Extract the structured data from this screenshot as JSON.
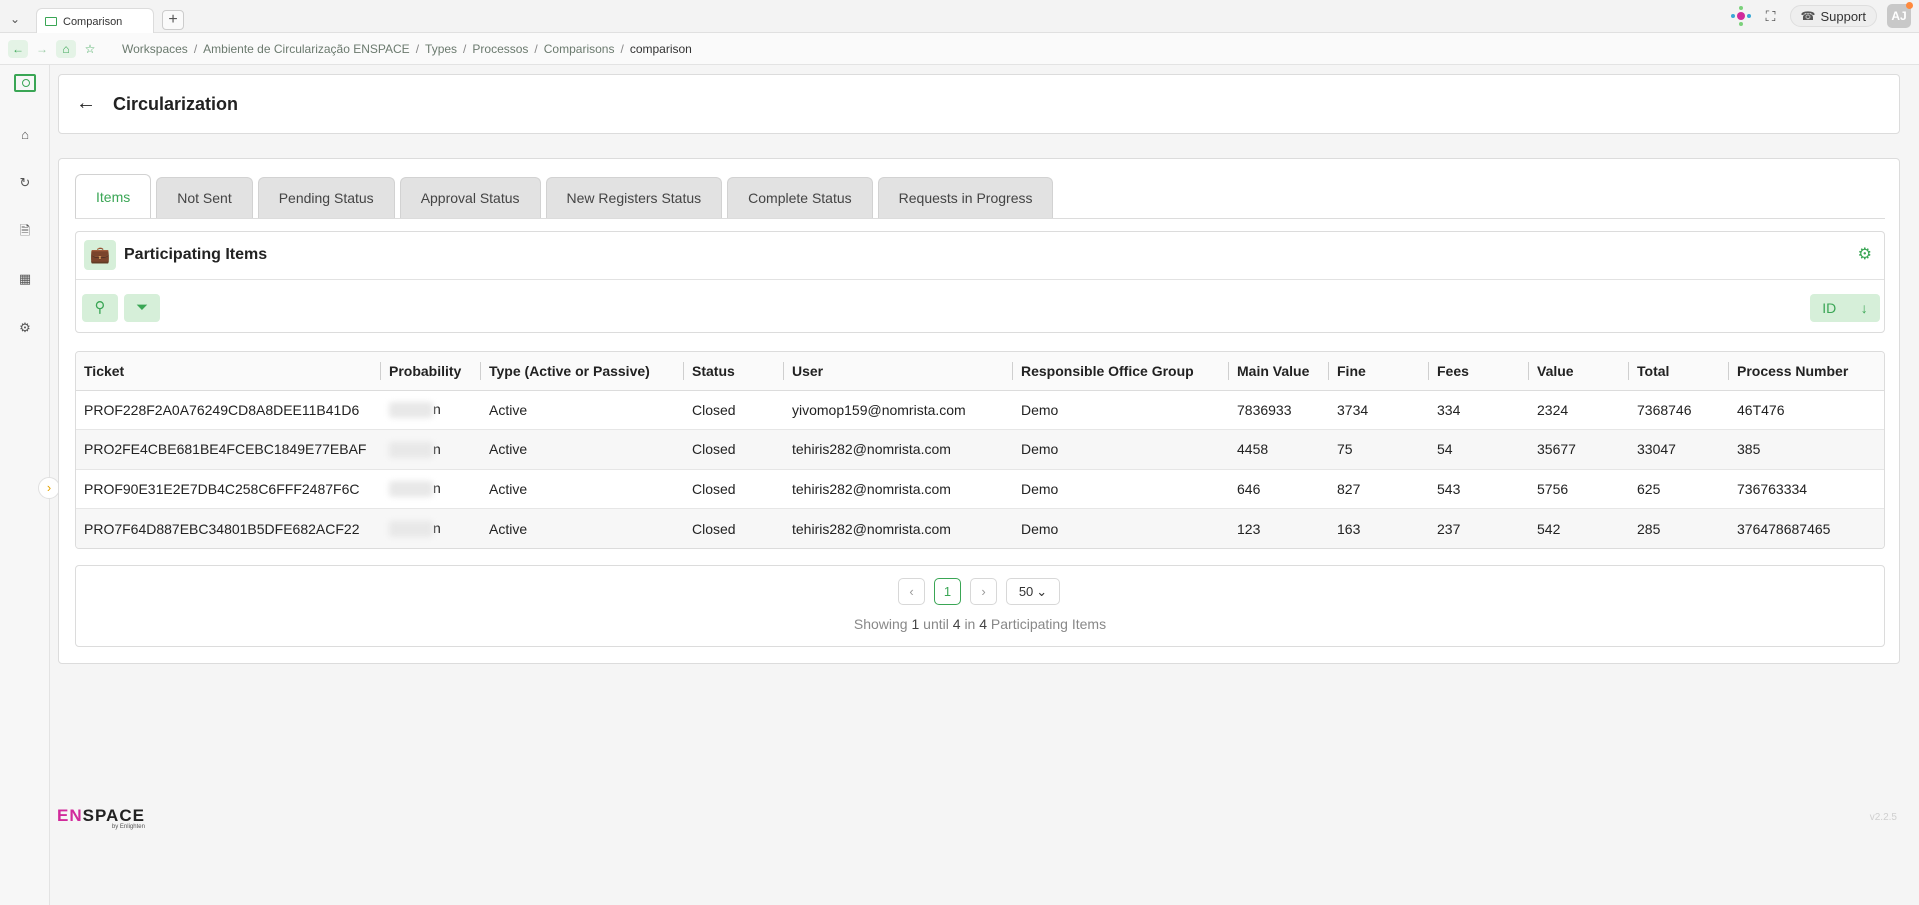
{
  "browser": {
    "tab_title": "Comparison",
    "new_tab": "+",
    "support_label": "Support",
    "avatar_initials": "AJ"
  },
  "breadcrumb": [
    "Workspaces",
    "Ambiente de Circularização ENSPACE",
    "Types",
    "Processos",
    "Comparisons",
    "comparison"
  ],
  "page": {
    "title": "Circularization"
  },
  "tabs": [
    "Items",
    "Not Sent",
    "Pending Status",
    "Approval Status",
    "New Registers Status",
    "Complete Status",
    "Requests in Progress"
  ],
  "card": {
    "title": "Participating Items",
    "sort_label": "ID"
  },
  "table": {
    "columns": [
      "Ticket",
      "Probability",
      "Type (Active or Passive)",
      "Status",
      "User",
      "Responsible Office Group",
      "Main Value",
      "Fine",
      "Fees",
      "Value",
      "Total",
      "Process Number"
    ],
    "rows": [
      [
        "PROF228F2A0A76249CD8A8DEE11B41D6",
        "n",
        "Active",
        "Closed",
        "yivomop159@nomrista.com",
        "Demo",
        "7836933",
        "3734",
        "334",
        "2324",
        "7368746",
        "46T476"
      ],
      [
        "PRO2FE4CBE681BE4FCEBC1849E77EBAF",
        "n",
        "Active",
        "Closed",
        "tehiris282@nomrista.com",
        "Demo",
        "4458",
        "75",
        "54",
        "35677",
        "33047",
        "385"
      ],
      [
        "PROF90E31E2E7DB4C258C6FFF2487F6C",
        "n",
        "Active",
        "Closed",
        "tehiris282@nomrista.com",
        "Demo",
        "646",
        "827",
        "543",
        "5756",
        "625",
        "736763334"
      ],
      [
        "PRO7F64D887EBC34801B5DFE682ACF22",
        "n",
        "Active",
        "Closed",
        "tehiris282@nomrista.com",
        "Demo",
        "123",
        "163",
        "237",
        "542",
        "285",
        "376478687465"
      ]
    ]
  },
  "pagination": {
    "current_page": "1",
    "page_size": "50",
    "summary_prefix": "Showing",
    "from": "1",
    "until_word": "until",
    "to": "4",
    "in_word": "in",
    "total": "4",
    "summary_suffix": "Participating Items"
  },
  "footer": {
    "logo_en": "EN",
    "logo_space": "SPACE",
    "logo_sub": "by Enlighten",
    "version": "v2.2.5"
  },
  "colors": {
    "accent": "#3aa655",
    "accent_light": "#d6efd9",
    "brand_pink": "#d12a9b"
  }
}
